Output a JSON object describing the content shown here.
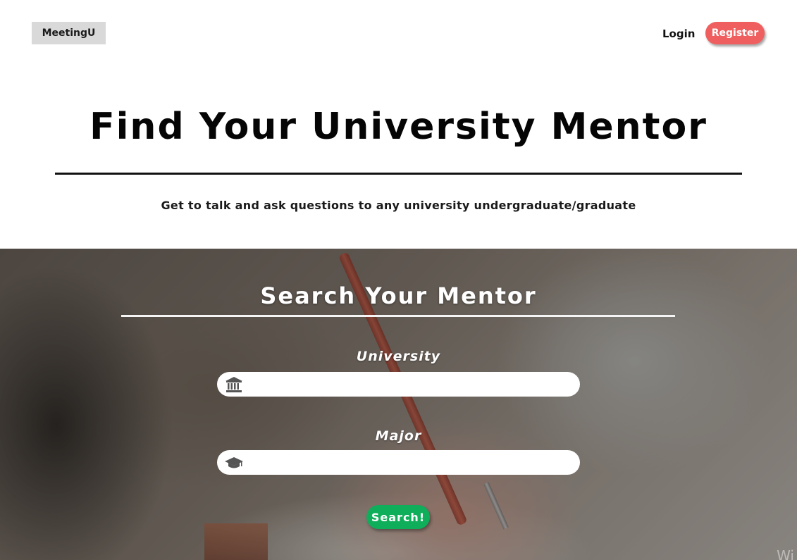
{
  "header": {
    "logo": "MeetingU",
    "login_label": "Login",
    "register_label": "Register"
  },
  "hero": {
    "title": "Find Your University Mentor",
    "subtitle": "Get to talk and ask questions to any university undergraduate/graduate"
  },
  "search": {
    "title": "Search Your Mentor",
    "university_label": "University",
    "university_value": "",
    "university_icon": "university-icon",
    "major_label": "Major",
    "major_value": "",
    "major_icon": "graduation-cap-icon",
    "button_label": "Search!"
  },
  "colors": {
    "register": "#ef5f5f",
    "search_button": "#0fae5a",
    "logo_bg": "#d9d9d9"
  },
  "watermark": "Wi"
}
